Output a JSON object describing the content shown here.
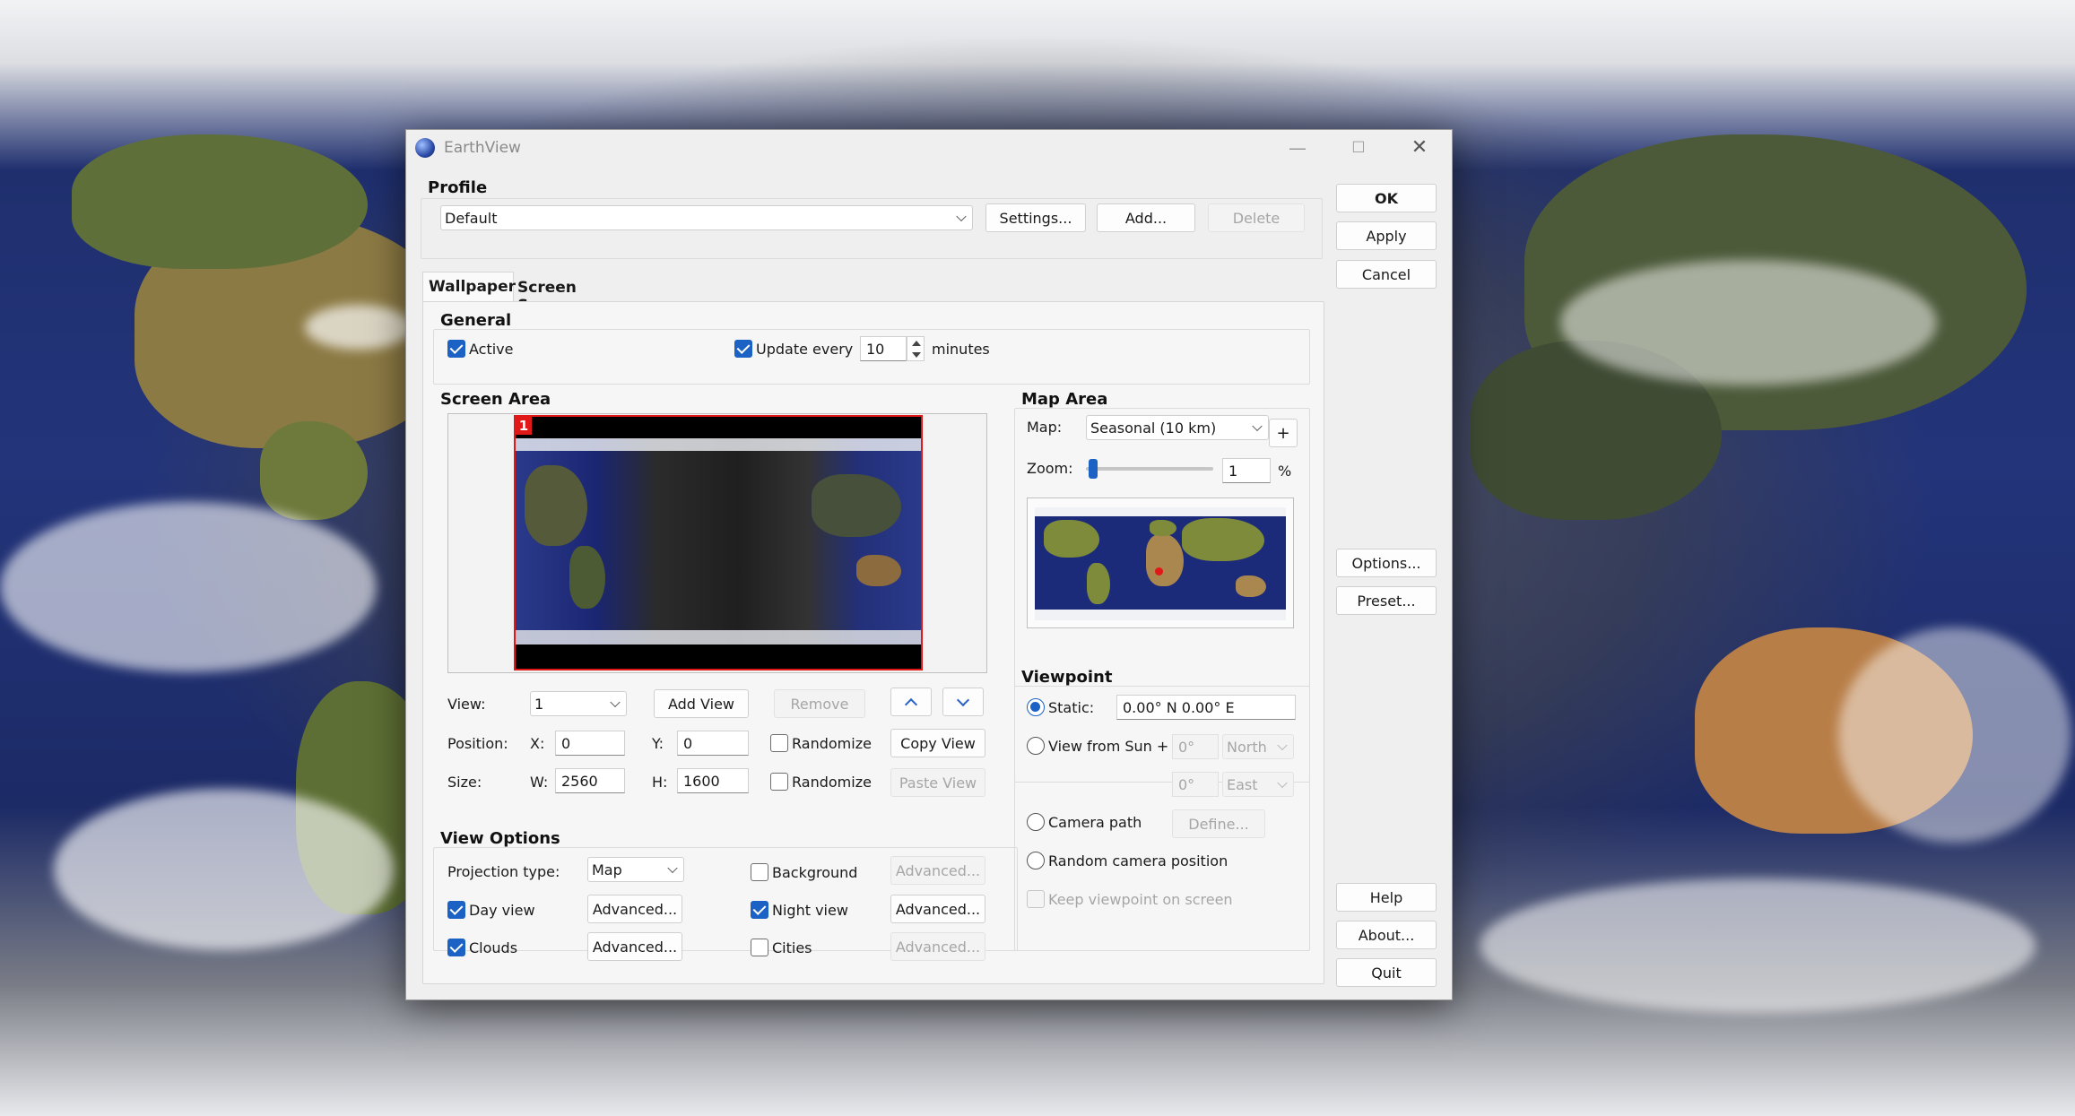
{
  "window": {
    "title": "EarthView",
    "minimize": "—",
    "maximize": "☐",
    "close": "✕"
  },
  "profile": {
    "title": "Profile",
    "selected": "Default",
    "settings_label": "Settings...",
    "add_label": "Add...",
    "delete_label": "Delete"
  },
  "side_buttons": {
    "ok": "OK",
    "apply": "Apply",
    "cancel": "Cancel",
    "options": "Options...",
    "preset": "Preset...",
    "help": "Help",
    "about": "About...",
    "quit": "Quit"
  },
  "tabs": [
    {
      "label": "Wallpaper",
      "active": true
    },
    {
      "label": "Screen Saver",
      "active": false
    }
  ],
  "general": {
    "title": "General",
    "active_label": "Active",
    "active_checked": true,
    "update_label": "Update every",
    "update_checked": true,
    "update_value": "10",
    "update_unit": "minutes"
  },
  "screen_area": {
    "title": "Screen Area",
    "monitor_number": "1",
    "view_label": "View:",
    "view_value": "1",
    "add_view": "Add View",
    "remove": "Remove",
    "position_label": "Position:",
    "x_label": "X:",
    "x_value": "0",
    "y_label": "Y:",
    "y_value": "0",
    "randomize_label": "Randomize",
    "copy_view": "Copy View",
    "size_label": "Size:",
    "w_label": "W:",
    "w_value": "2560",
    "h_label": "H:",
    "h_value": "1600",
    "paste_view": "Paste View"
  },
  "map_area": {
    "title": "Map Area",
    "map_label": "Map:",
    "map_value": "Seasonal (10 km)",
    "plus": "+",
    "zoom_label": "Zoom:",
    "zoom_value": "1",
    "zoom_unit": "%",
    "zoom_level": 0.02
  },
  "viewpoint": {
    "title": "Viewpoint",
    "static_label": "Static:",
    "static_value": "0.00° N   0.00° E",
    "sun_label": "View from Sun +",
    "sun_lat": "0°",
    "sun_lat_dir": "North",
    "sun_lon": "0°",
    "sun_lon_dir": "East",
    "camera_path_label": "Camera path",
    "define_label": "Define...",
    "random_camera_label": "Random camera position",
    "keep_viewpoint_label": "Keep viewpoint on screen"
  },
  "view_options": {
    "title": "View Options",
    "projection_label": "Projection type:",
    "projection_value": "Map",
    "day_view_label": "Day view",
    "clouds_label": "Clouds",
    "background_label": "Background",
    "night_view_label": "Night view",
    "cities_label": "Cities",
    "advanced_label": "Advanced..."
  },
  "colors": {
    "accent": "#1b62c4",
    "monitor_border": "#e01818",
    "ocean": "#1c2a7a"
  }
}
